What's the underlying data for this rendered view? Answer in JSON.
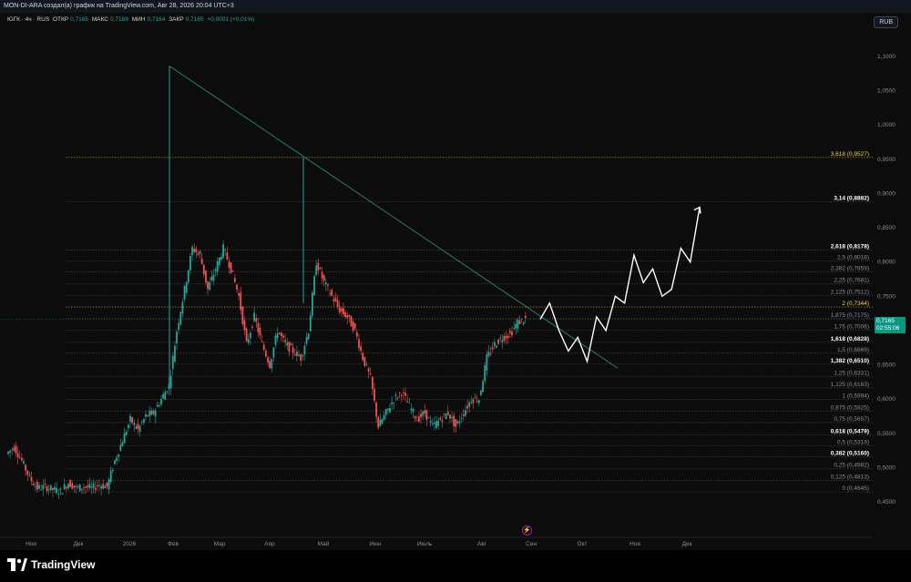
{
  "header": {
    "title": "MON-DI-ARA создал(а) график на TradingView.com, Авг 28, 2026 20:04 UTC+3"
  },
  "legend": {
    "symbol": "ЮГК · 4ч · RUS",
    "open_label": "ОТКР",
    "open": "0,7165",
    "high_label": "МАКС",
    "high": "0,7169",
    "low_label": "МИН",
    "low": "0,7164",
    "close_label": "ЗАКР",
    "close": "0,7165",
    "change": "+0,0001 (+0,01%)"
  },
  "currency_button": "RUB",
  "price_tag": {
    "price": "0,7165",
    "countdown": "02:55:06",
    "color": "#089981"
  },
  "footer": {
    "logo_text": "TradingView"
  },
  "colors": {
    "background": "#0c0c0c",
    "up_candle": "#26a69a",
    "down_candle": "#ef5350",
    "trendline": "#1f8a78",
    "fib_line": "#444444",
    "fib_highlight": "#f0d34a",
    "projection": "#ffffff"
  },
  "chart_data": {
    "type": "line",
    "title": "",
    "xlabel": "",
    "ylabel": "",
    "ylim": [
      0.44,
      1.12
    ],
    "x_ticks": [
      "Ноя",
      "Дек",
      "2026",
      "Фев",
      "Мар",
      "Апр",
      "Май",
      "Июн",
      "Июль",
      "Авг",
      "Сен",
      "Окт",
      "Ноя",
      "Дек"
    ],
    "y_ticks": [
      "1,1000",
      "1,0500",
      "1,0000",
      "0,9500",
      "0,9000",
      "0,8500",
      "0,8000",
      "0,7500",
      "0,7000",
      "0,6500",
      "0,6000",
      "0,5500",
      "0,5000",
      "0,4500"
    ],
    "y_tick_values": [
      1.1,
      1.05,
      1.0,
      0.95,
      0.9,
      0.85,
      0.8,
      0.75,
      0.7,
      0.65,
      0.6,
      0.55,
      0.5,
      0.45
    ],
    "price_series": {
      "name": "",
      "points": [
        [
          0,
          0.52
        ],
        [
          1,
          0.53
        ],
        [
          2,
          0.51
        ],
        [
          3,
          0.485
        ],
        [
          4,
          0.47
        ],
        [
          5,
          0.472
        ],
        [
          6,
          0.468
        ],
        [
          7,
          0.465
        ],
        [
          8,
          0.478
        ],
        [
          9,
          0.47
        ],
        [
          10,
          0.472
        ],
        [
          11,
          0.47
        ],
        [
          12,
          0.475
        ],
        [
          13,
          0.472
        ],
        [
          14,
          0.51
        ],
        [
          15,
          0.54
        ],
        [
          16,
          0.57
        ],
        [
          17,
          0.555
        ],
        [
          18,
          0.575
        ],
        [
          19,
          0.58
        ],
        [
          20,
          0.6
        ],
        [
          21,
          0.62
        ],
        [
          22,
          0.7
        ],
        [
          23,
          0.76
        ],
        [
          24,
          0.82
        ],
        [
          25,
          0.81
        ],
        [
          26,
          0.76
        ],
        [
          27,
          0.79
        ],
        [
          28,
          0.82
        ],
        [
          29,
          0.79
        ],
        [
          30,
          0.75
        ],
        [
          31,
          0.68
        ],
        [
          32,
          0.72
        ],
        [
          33,
          0.68
        ],
        [
          34,
          0.65
        ],
        [
          35,
          0.7
        ],
        [
          36,
          0.68
        ],
        [
          37,
          0.67
        ],
        [
          38,
          0.66
        ],
        [
          39,
          0.7
        ],
        [
          40,
          0.8
        ],
        [
          41,
          0.77
        ],
        [
          42,
          0.75
        ],
        [
          43,
          0.73
        ],
        [
          44,
          0.72
        ],
        [
          45,
          0.7
        ],
        [
          46,
          0.66
        ],
        [
          47,
          0.63
        ],
        [
          48,
          0.56
        ],
        [
          49,
          0.58
        ],
        [
          50,
          0.6
        ],
        [
          51,
          0.61
        ],
        [
          52,
          0.59
        ],
        [
          53,
          0.57
        ],
        [
          54,
          0.58
        ],
        [
          55,
          0.56
        ],
        [
          56,
          0.57
        ],
        [
          57,
          0.58
        ],
        [
          58,
          0.56
        ],
        [
          59,
          0.58
        ],
        [
          60,
          0.6
        ],
        [
          61,
          0.6
        ],
        [
          62,
          0.66
        ],
        [
          63,
          0.68
        ],
        [
          64,
          0.69
        ],
        [
          65,
          0.695
        ],
        [
          66,
          0.712
        ],
        [
          67,
          0.7165
        ]
      ]
    },
    "peaks": {
      "first_high": 1.086,
      "second_high": 0.953,
      "low": 0.4645
    },
    "trendline": {
      "from_value": 1.086,
      "to_value": 0.645
    },
    "fib_levels": [
      {
        "label": "3,618 (0,9527)",
        "ratio": 3.618,
        "value": 0.9527,
        "highlight": true
      },
      {
        "label": "3,14 (0,8882)",
        "ratio": 3.14,
        "value": 0.8882,
        "bold": true
      },
      {
        "label": "2,618 (0,8178)",
        "ratio": 2.618,
        "value": 0.8178,
        "bold": true
      },
      {
        "label": "2,5 (0,8018)",
        "ratio": 2.5,
        "value": 0.8018
      },
      {
        "label": "2,382 (0,7859)",
        "ratio": 2.382,
        "value": 0.7859
      },
      {
        "label": "2,25 (0,7681)",
        "ratio": 2.25,
        "value": 0.7681
      },
      {
        "label": "2,125 (0,7512)",
        "ratio": 2.125,
        "value": 0.7512
      },
      {
        "label": "2 (0,7344)",
        "ratio": 2.0,
        "value": 0.7344,
        "highlight": true
      },
      {
        "label": "1,875 (0,7175)",
        "ratio": 1.875,
        "value": 0.7175
      },
      {
        "label": "1,75 (0,7006)",
        "ratio": 1.75,
        "value": 0.7006
      },
      {
        "label": "1,618 (0,6828)",
        "ratio": 1.618,
        "value": 0.6828,
        "bold": true
      },
      {
        "label": "1,5 (0,6669)",
        "ratio": 1.5,
        "value": 0.6669
      },
      {
        "label": "1,382 (0,6510)",
        "ratio": 1.382,
        "value": 0.651,
        "bold": true
      },
      {
        "label": "1,25 (0,6331)",
        "ratio": 1.25,
        "value": 0.6331
      },
      {
        "label": "1,125 (0,6163)",
        "ratio": 1.125,
        "value": 0.6163
      },
      {
        "label": "1 (0,5994)",
        "ratio": 1.0,
        "value": 0.5994
      },
      {
        "label": "0,875 (0,5825)",
        "ratio": 0.875,
        "value": 0.5825
      },
      {
        "label": "0,75 (0,5657)",
        "ratio": 0.75,
        "value": 0.5657
      },
      {
        "label": "0,618 (0,5479)",
        "ratio": 0.618,
        "value": 0.5479,
        "bold": true
      },
      {
        "label": "0,5 (0,5319)",
        "ratio": 0.5,
        "value": 0.5319
      },
      {
        "label": "0,382 (0,5160)",
        "ratio": 0.382,
        "value": 0.516,
        "bold": true
      },
      {
        "label": "0,25 (0,4982)",
        "ratio": 0.25,
        "value": 0.4982
      },
      {
        "label": "0,125 (0,4813)",
        "ratio": 0.125,
        "value": 0.4813
      },
      {
        "label": "0 (0,4645)",
        "ratio": 0.0,
        "value": 0.4645
      }
    ],
    "projection": {
      "name": "",
      "values": [
        0.7165,
        0.74,
        0.7,
        0.67,
        0.69,
        0.655,
        0.72,
        0.7,
        0.75,
        0.74,
        0.81,
        0.77,
        0.79,
        0.75,
        0.76,
        0.82,
        0.8,
        0.88
      ]
    },
    "grid": false,
    "legend_position": "top-left"
  }
}
